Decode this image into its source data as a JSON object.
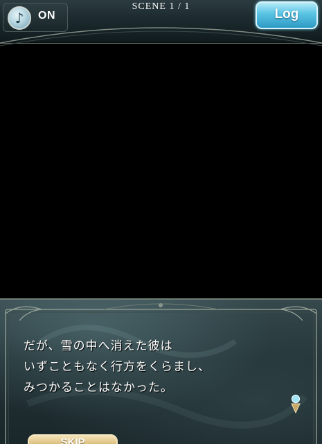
{
  "top_bar": {
    "sound_toggle": {
      "icon": "music-note-icon",
      "state_label": "ON"
    },
    "scene_indicator": "SCENE  1 / 1",
    "log_button_label": "Log"
  },
  "message_window": {
    "lines": [
      "だが、雪の中へ消えた彼は",
      "いずこともなく行方をくらまし、",
      "みつかることはなかった。"
    ],
    "next_indicator_icon": "next-page-indicator-icon",
    "skip_button_label": "SKIP"
  },
  "colors": {
    "scene_background": "#000000",
    "frame_dark": "#1c2a2e",
    "log_button": "#5ec7e6",
    "skip_button": "#d9b977",
    "text": "#ffffff"
  }
}
